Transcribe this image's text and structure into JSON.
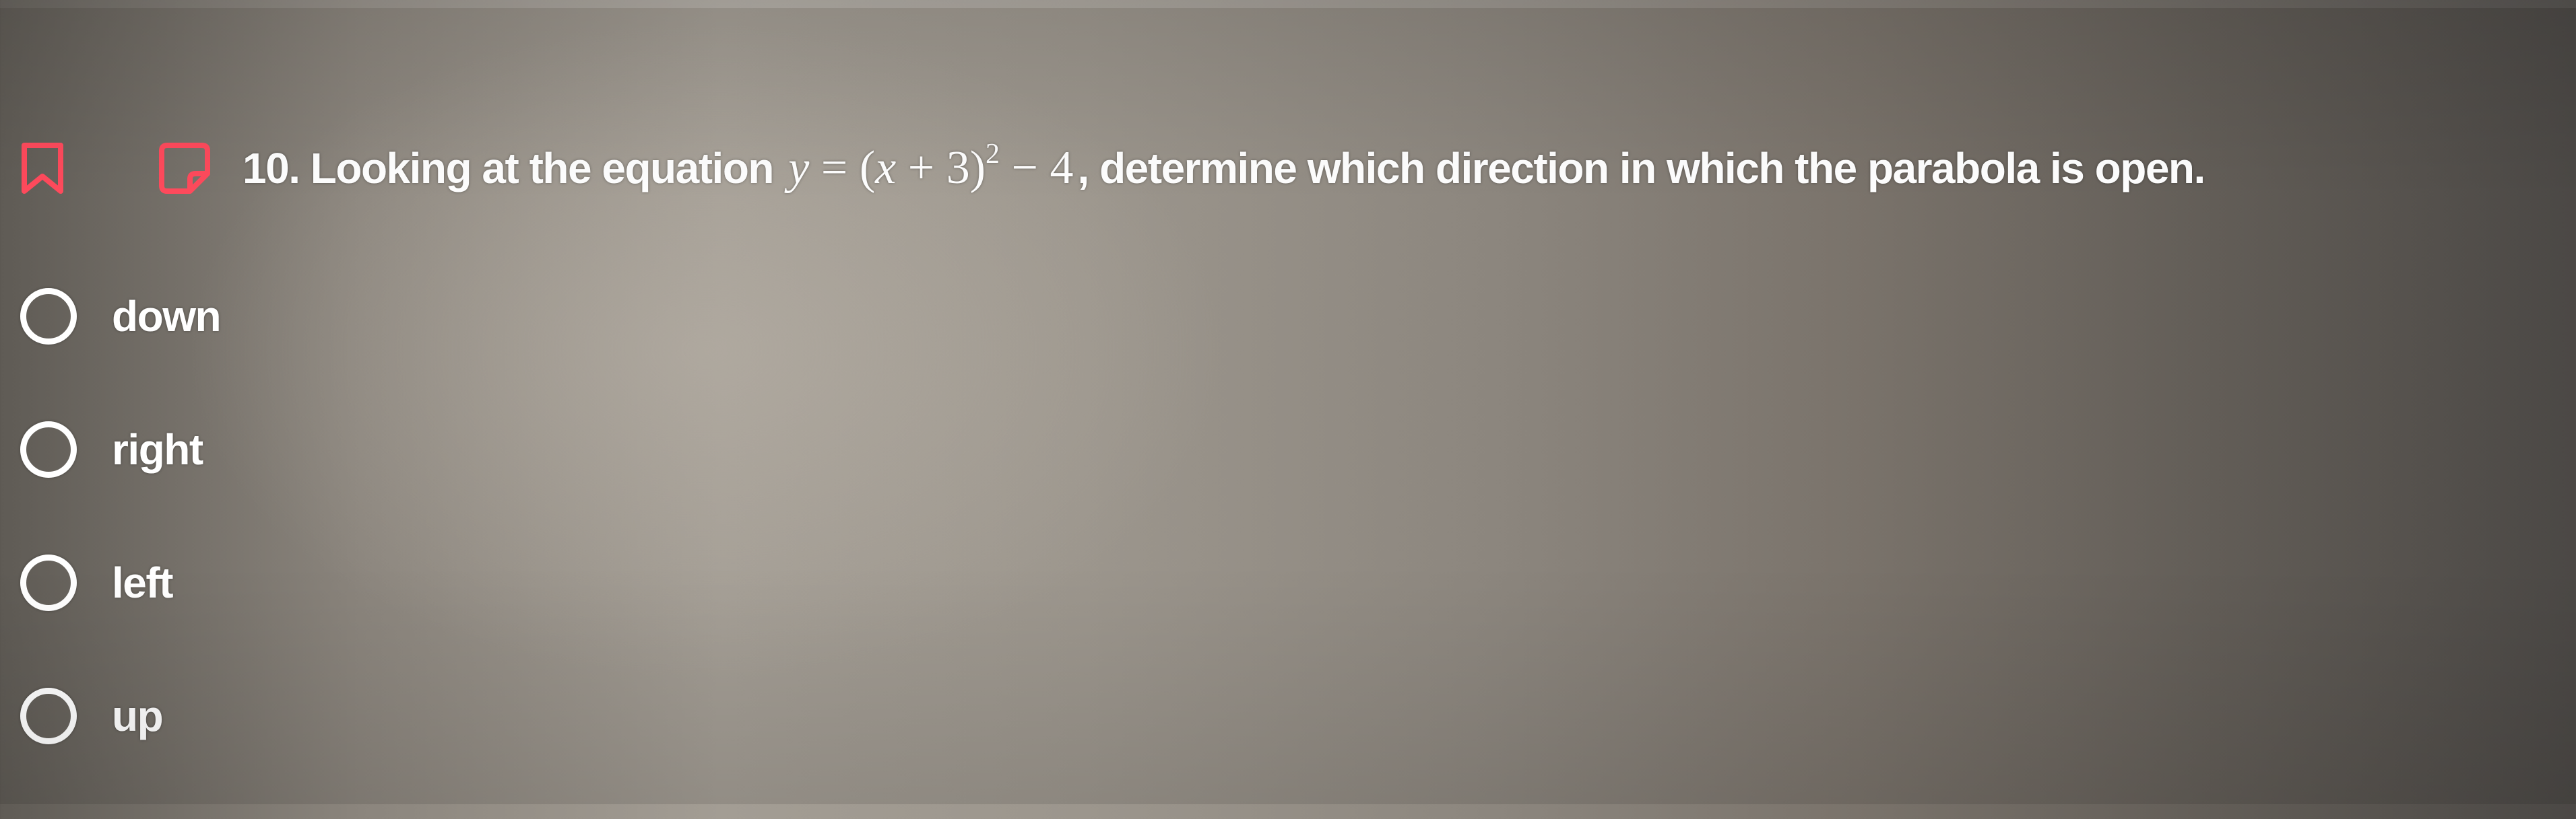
{
  "question": {
    "number_prefix": "10. Looking at the equation",
    "equation": {
      "y": "y",
      "equals": " = (",
      "x": "x",
      "plus_three": " + 3)",
      "exponent": "2",
      "minus_four": " − 4"
    },
    "suffix": ", determine which direction in which the parabola is open."
  },
  "icons": {
    "bookmark": "bookmark-icon",
    "note": "note-icon",
    "accent_color": "#ff4a5c"
  },
  "options": [
    {
      "label": "down"
    },
    {
      "label": "right"
    },
    {
      "label": "left"
    },
    {
      "label": "up"
    }
  ]
}
